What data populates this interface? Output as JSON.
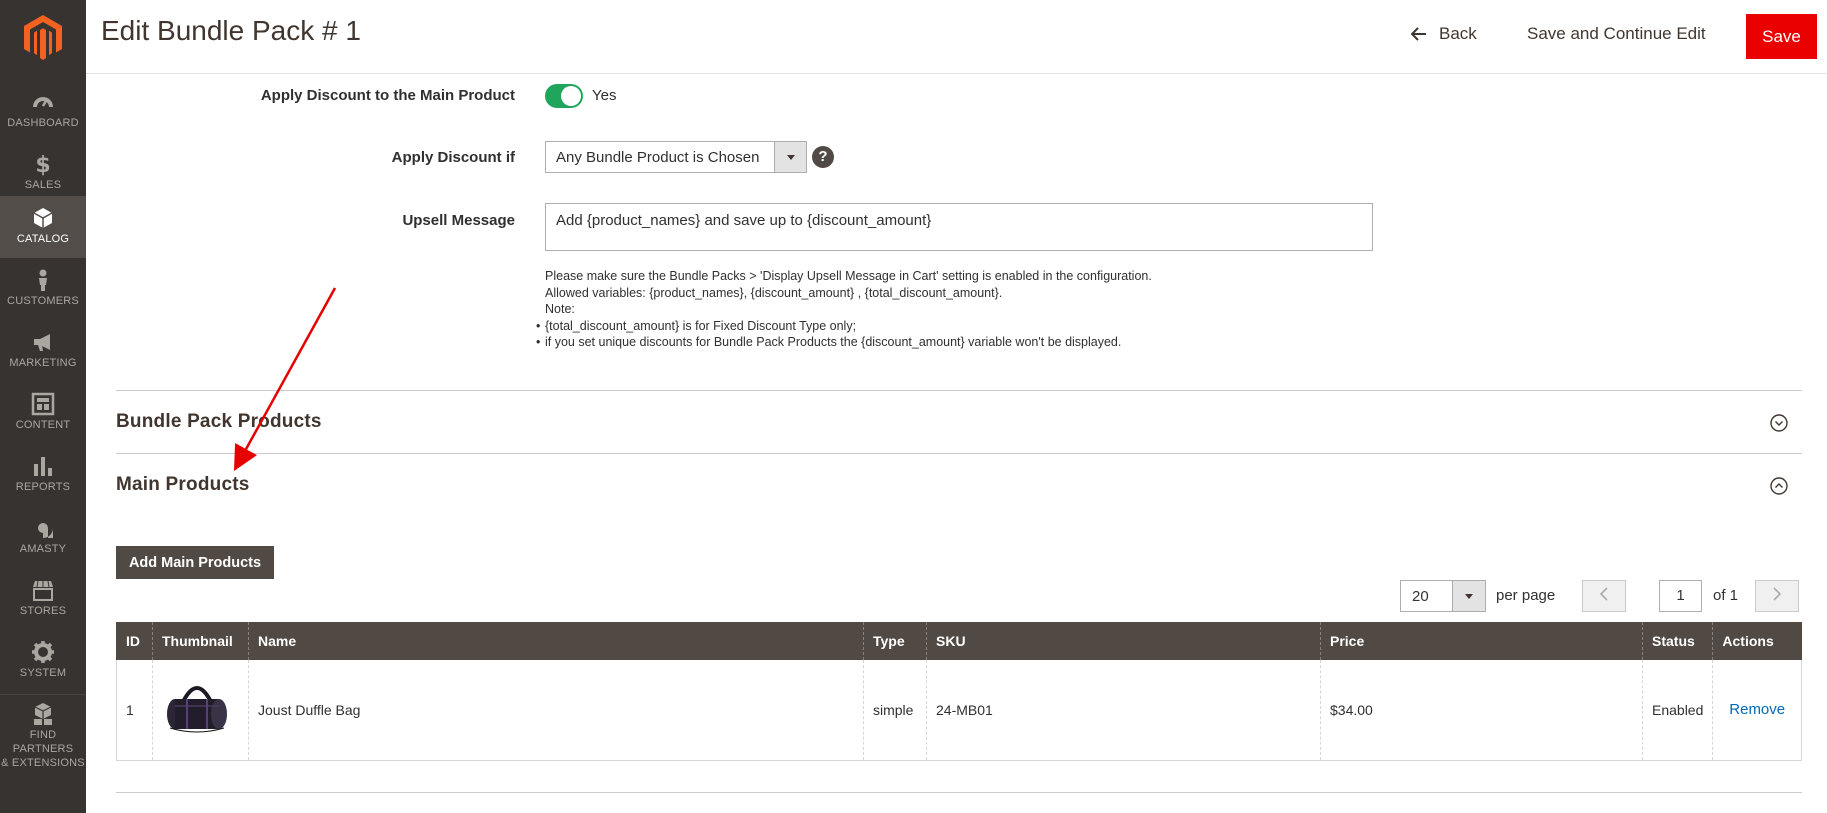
{
  "sidebar": {
    "items": [
      {
        "label": "DASHBOARD",
        "icon": "dashboard-icon"
      },
      {
        "label": "SALES",
        "icon": "dollar-icon"
      },
      {
        "label": "CATALOG",
        "icon": "cube-icon"
      },
      {
        "label": "CUSTOMERS",
        "icon": "person-icon"
      },
      {
        "label": "MARKETING",
        "icon": "megaphone-icon"
      },
      {
        "label": "CONTENT",
        "icon": "layout-icon"
      },
      {
        "label": "REPORTS",
        "icon": "bar-chart-icon"
      },
      {
        "label": "AMASTY",
        "icon": "amasty-icon"
      },
      {
        "label": "STORES",
        "icon": "store-icon"
      },
      {
        "label": "SYSTEM",
        "icon": "gear-icon"
      },
      {
        "label": "FIND PARTNERS",
        "label2": "& EXTENSIONS",
        "icon": "boxes-icon"
      }
    ],
    "active_index": 2
  },
  "header": {
    "title": "Edit Bundle Pack # 1",
    "back_label": "Back",
    "save_continue_label": "Save and Continue Edit",
    "save_label": "Save"
  },
  "form": {
    "apply_discount_main": {
      "label": "Apply Discount to the Main Product",
      "value": "Yes",
      "enabled": true
    },
    "apply_discount_if": {
      "label": "Apply Discount if",
      "value": "Any Bundle Product is Chosen",
      "help": "?"
    },
    "upsell_message": {
      "label": "Upsell Message",
      "value": "Add {product_names} and save up to {discount_amount}"
    },
    "notes": {
      "line1": "Please make sure the Bundle Packs > 'Display Upsell Message in Cart' setting is enabled in the configuration.",
      "line2": "Allowed variables: {product_names}, {discount_amount} , {total_discount_amount}.",
      "line3": "Note:",
      "bullets": [
        "{total_discount_amount} is for Fixed Discount Type only;",
        "if you set unique discounts for Bundle Pack Products the {discount_amount} variable won't be displayed."
      ]
    }
  },
  "sections": {
    "bundle_pack_products": "Bundle Pack Products",
    "main_products": "Main Products"
  },
  "add_main_products_label": "Add Main Products",
  "pager": {
    "per_page_value": "20",
    "per_page_label": "per page",
    "current_page": "1",
    "of_label": "of 1"
  },
  "table": {
    "headers": [
      "ID",
      "Thumbnail",
      "Name",
      "Type",
      "SKU",
      "Price",
      "Status",
      "Actions"
    ],
    "rows": [
      {
        "id": "1",
        "name": "Joust Duffle Bag",
        "type": "simple",
        "sku": "24-MB01",
        "price": "$34.00",
        "status": "Enabled",
        "action": "Remove"
      }
    ]
  },
  "colors": {
    "sidebar_bg": "#373330",
    "sidebar_active": "#524d49",
    "brand_red": "#eb0000",
    "header_text": "#41362f",
    "table_header_bg": "#514943",
    "toggle_on": "#1fa65c",
    "link": "#006bb4",
    "annotation_arrow": "#e60000"
  }
}
